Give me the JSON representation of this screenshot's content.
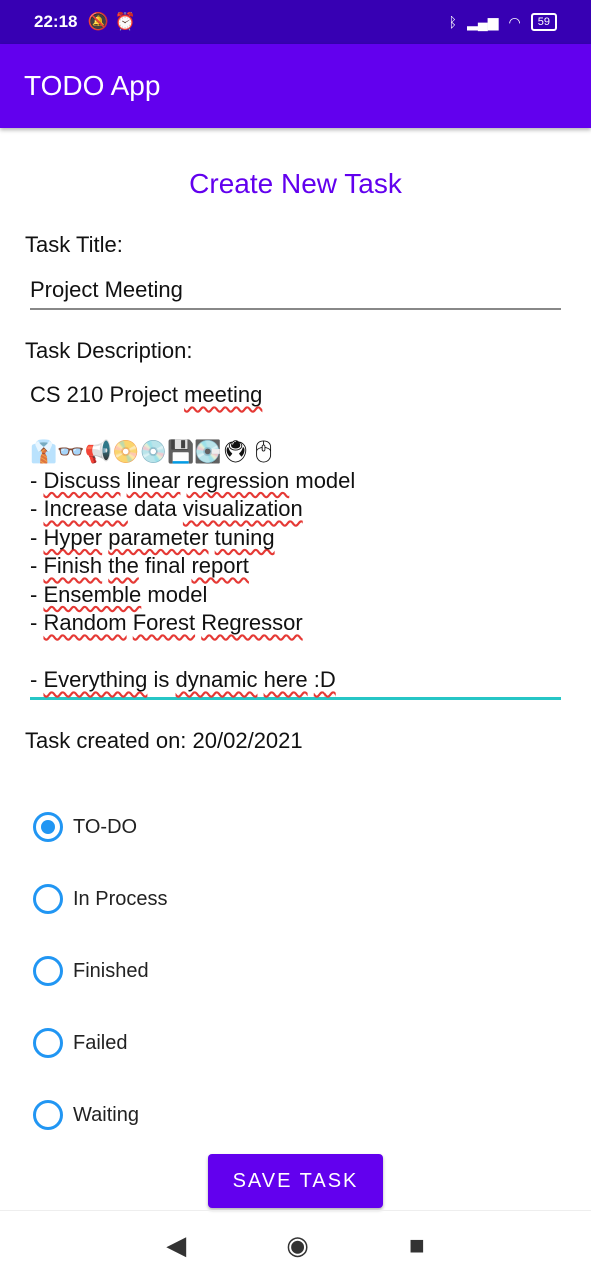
{
  "status": {
    "time": "22:18",
    "battery": "59"
  },
  "app": {
    "title": "TODO App"
  },
  "form": {
    "heading": "Create New Task",
    "title_label": "Task Title:",
    "title_value": "Project Meeting",
    "desc_label": "Task Description:",
    "desc_lines": [
      [
        {
          "t": "CS 210 Project "
        },
        {
          "t": "meeting",
          "err": true
        }
      ],
      [
        {
          "t": " "
        }
      ],
      [
        {
          "t": "👔👓📢📀💿💾💽🖲🖱"
        }
      ],
      [
        {
          "t": "- "
        },
        {
          "t": "Discuss",
          "err": true
        },
        {
          "t": " "
        },
        {
          "t": "linear",
          "err": true
        },
        {
          "t": " "
        },
        {
          "t": "regression",
          "err": true
        },
        {
          "t": " model"
        }
      ],
      [
        {
          "t": "- "
        },
        {
          "t": "Increase",
          "err": true
        },
        {
          "t": " data "
        },
        {
          "t": "visualization",
          "err": true
        }
      ],
      [
        {
          "t": "- "
        },
        {
          "t": "Hyper",
          "err": true
        },
        {
          "t": " "
        },
        {
          "t": "parameter",
          "err": true
        },
        {
          "t": " "
        },
        {
          "t": "tuning",
          "err": true
        }
      ],
      [
        {
          "t": "- "
        },
        {
          "t": "Finish",
          "err": true
        },
        {
          "t": " "
        },
        {
          "t": "the",
          "err": true
        },
        {
          "t": " final "
        },
        {
          "t": "report",
          "err": true
        }
      ],
      [
        {
          "t": "- "
        },
        {
          "t": "Ensemble",
          "err": true
        },
        {
          "t": " model"
        }
      ],
      [
        {
          "t": "- "
        },
        {
          "t": "Random",
          "err": true
        },
        {
          "t": " "
        },
        {
          "t": "Forest",
          "err": true
        },
        {
          "t": " "
        },
        {
          "t": "Regressor",
          "err": true
        }
      ],
      [
        {
          "t": " "
        }
      ],
      [
        {
          "t": "- "
        },
        {
          "t": "Everything",
          "err": true
        },
        {
          "t": " is "
        },
        {
          "t": "dynamic",
          "err": true
        },
        {
          "t": " "
        },
        {
          "t": "here",
          "err": true
        },
        {
          "t": " "
        },
        {
          "t": ":D",
          "err": true
        }
      ]
    ],
    "created": "Task created on: 20/02/2021",
    "statuses": [
      "TO-DO",
      "In Process",
      "Finished",
      "Failed",
      "Waiting"
    ],
    "selected": 0,
    "save": "SAVE TASK"
  },
  "colors": {
    "primary": "#6200ee",
    "status_bar": "#3700b3",
    "radio": "#2196f3",
    "focus_line": "#26c6c6"
  }
}
